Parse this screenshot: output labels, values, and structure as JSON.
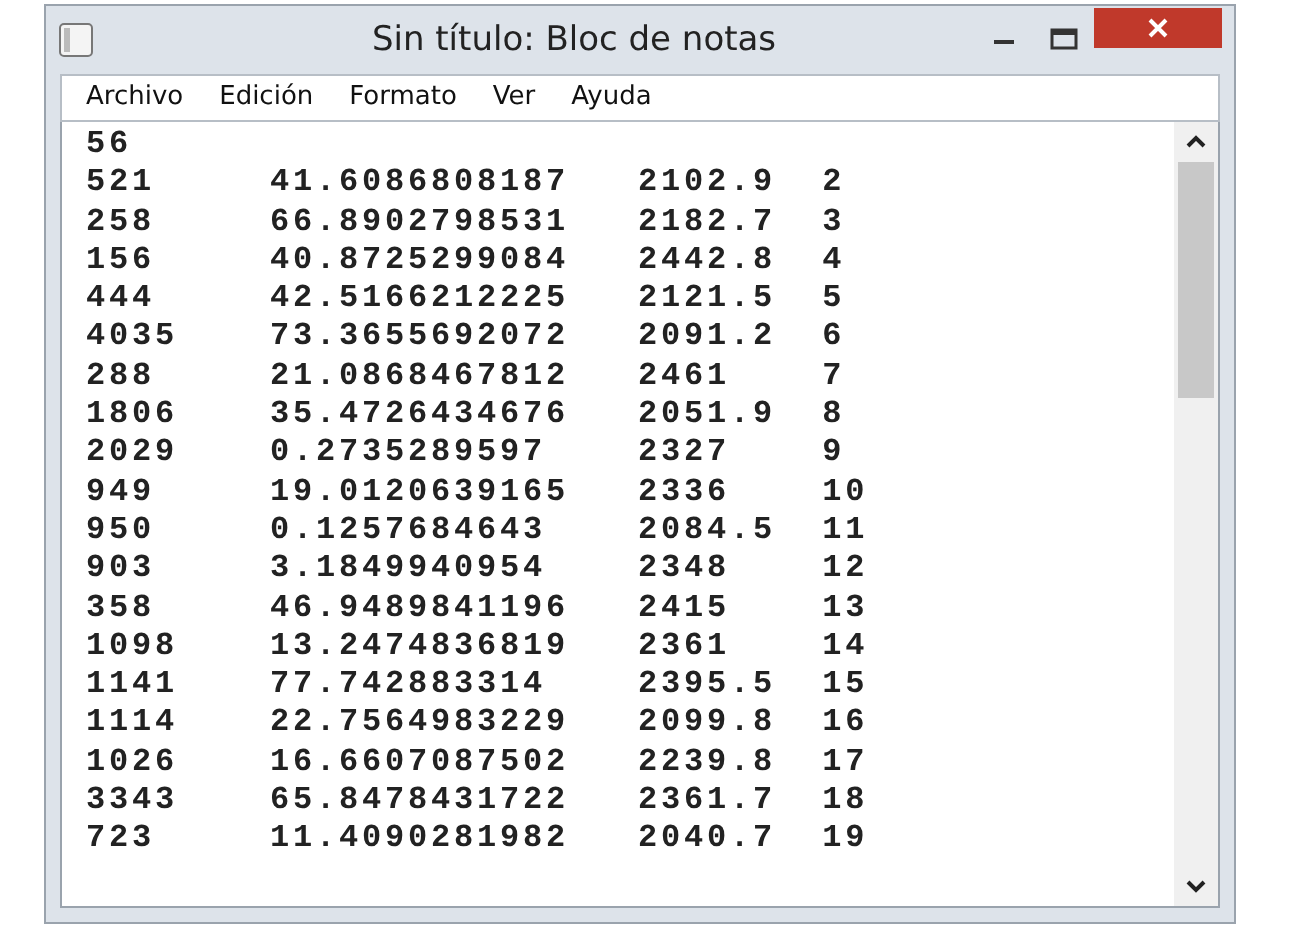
{
  "window": {
    "title": "Sin título: Bloc de notas"
  },
  "menu": [
    "Archivo",
    "Edición",
    "Formato",
    "Ver",
    "Ayuda"
  ],
  "lines": [
    "56",
    "521\t41.6086808187\t2102.9\t2",
    "258\t66.8902798531\t2182.7\t3",
    "156\t40.8725299084\t2442.8\t4",
    "444\t42.5166212225\t2121.5\t5",
    "4035\t73.3655692072\t2091.2\t6",
    "288\t21.0868467812\t2461\t7",
    "1806\t35.4726434676\t2051.9\t8",
    "2029\t0.2735289597\t2327\t9",
    "949\t19.0120639165\t2336\t10",
    "950\t0.1257684643\t2084.5\t11",
    "903\t3.1849940954\t2348\t12",
    "358\t46.9489841196\t2415\t13",
    "1098\t13.2474836819\t2361\t14",
    "1141\t77.742883314\t2395.5\t15",
    "1114\t22.7564983229\t2099.8\t16",
    "1026\t16.6607087502\t2239.8\t17",
    "3343\t65.8478431722\t2361.7\t18",
    "723\t11.4090281982\t2040.7\t19"
  ]
}
